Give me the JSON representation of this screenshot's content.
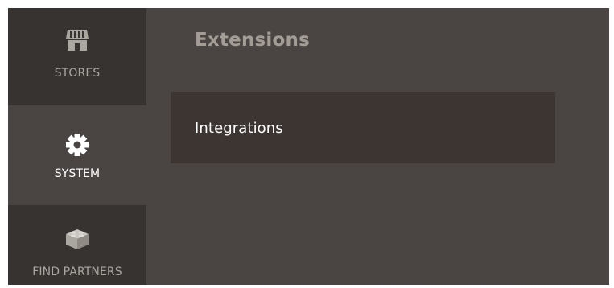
{
  "sidebar": {
    "items": [
      {
        "label": "STORES",
        "icon": "store-icon"
      },
      {
        "label": "SYSTEM",
        "icon": "gear-icon",
        "active": true
      },
      {
        "label": "FIND PARTNERS",
        "icon": "lego-brick-icon"
      }
    ]
  },
  "panel": {
    "title": "Extensions",
    "items": [
      {
        "label": "Integrations"
      }
    ]
  },
  "colors": {
    "frame_bg": "#4a4542",
    "sidebar_inactive_bg": "#373330",
    "submenu_item_bg": "#3d3532",
    "title_color": "#a49d95",
    "inactive_label": "#aaa6a0",
    "active_label": "#ffffff"
  }
}
